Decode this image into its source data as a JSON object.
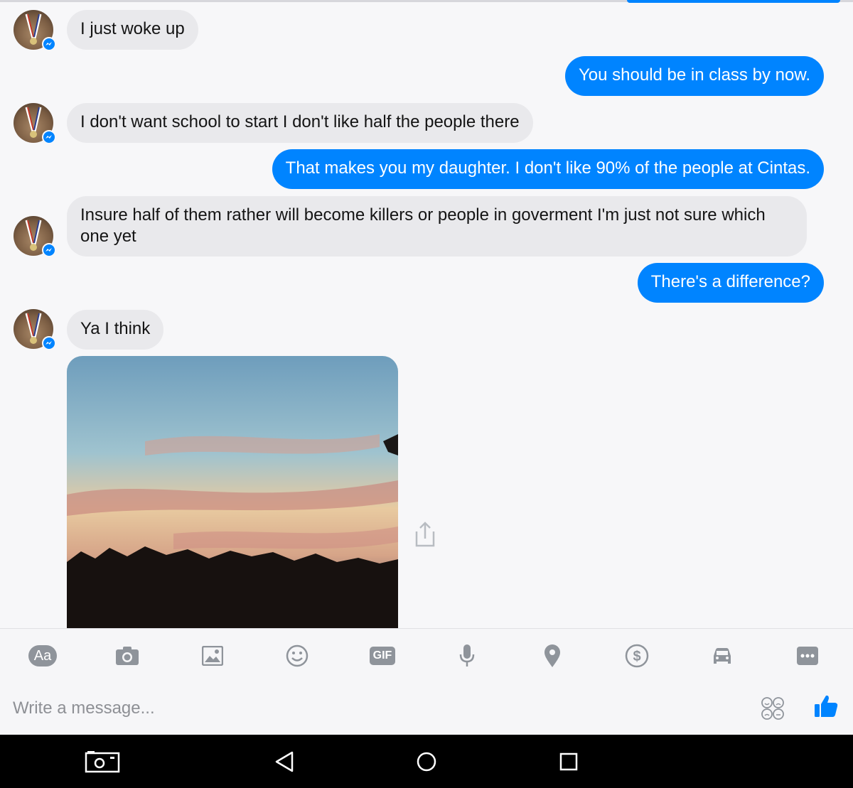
{
  "messages": [
    {
      "sender": "them",
      "text": "I just woke up"
    },
    {
      "sender": "me",
      "text": "You should be in class by now."
    },
    {
      "sender": "them",
      "text": "I don't want school to start I don't like half the people there"
    },
    {
      "sender": "me",
      "text": "That makes you my daughter. I don't like 90% of the people at Cintas."
    },
    {
      "sender": "them",
      "text": "Insure half of them rather will become killers or people in goverment I'm just not sure which one yet"
    },
    {
      "sender": "me",
      "text": "There's a difference?"
    },
    {
      "sender": "them",
      "text": "Ya I think"
    }
  ],
  "toolbar": {
    "text_button_label": "Aa",
    "gif_button_label": "GIF",
    "icons": [
      "text-format-icon",
      "camera-icon",
      "gallery-icon",
      "emoji-icon",
      "gif-icon",
      "microphone-icon",
      "location-icon",
      "payment-icon",
      "ride-icon",
      "more-icon"
    ]
  },
  "composer": {
    "placeholder": "Write a message..."
  },
  "colors": {
    "outgoing_bubble": "#0084ff",
    "incoming_bubble": "#e9e9ec",
    "icon_gray": "#8f949b",
    "like_blue": "#0084ff"
  }
}
